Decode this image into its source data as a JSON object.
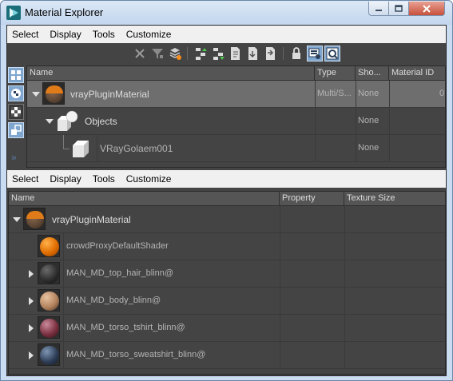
{
  "window": {
    "title": "Material Explorer"
  },
  "top": {
    "menu": [
      "Select",
      "Display",
      "Tools",
      "Customize"
    ],
    "columns": [
      "Name",
      "Type",
      "Sho...",
      "Material ID"
    ],
    "rows": [
      {
        "name": "vrayPluginMaterial",
        "type": "Multi/S...",
        "show": "None",
        "material_id": "0"
      },
      {
        "name": "Objects",
        "type": "",
        "show": "None",
        "material_id": ""
      },
      {
        "name": "VRayGolaem001",
        "type": "",
        "show": "None",
        "material_id": ""
      }
    ]
  },
  "bottom": {
    "menu": [
      "Select",
      "Display",
      "Tools",
      "Customize"
    ],
    "columns": [
      "Name",
      "Property",
      "Texture Size"
    ],
    "rows": [
      {
        "name": "vrayPluginMaterial"
      },
      {
        "name": "crowdProxyDefaultShader"
      },
      {
        "name": "MAN_MD_top_hair_blinn@"
      },
      {
        "name": "MAN_MD_body_blinn@"
      },
      {
        "name": "MAN_MD_torso_tshirt_blinn@"
      },
      {
        "name": "MAN_MD_torso_sweatshirt_blinn@"
      }
    ]
  },
  "side_expand": "»",
  "icons": {
    "app": "3ds-max-icon",
    "window_controls": [
      "minimize-icon",
      "maximize-icon",
      "close-icon"
    ],
    "toolbar": [
      "delete-icon",
      "filter-icon",
      "layers-icon",
      "hierarchy-up-icon",
      "hierarchy-down-icon",
      "export-icon",
      "import-icon",
      "sync-icon",
      "lock-icon",
      "display-mode-icon",
      "display-mode-alt-icon"
    ],
    "side": [
      "list-view-icon",
      "checker-icon",
      "checker-alt-icon",
      "instance-icon"
    ]
  },
  "colors": {
    "accent": "#7fa6cf",
    "panel": "#444444",
    "selected_row": "#6e6e6e",
    "menubar": "#f0f0f0"
  }
}
